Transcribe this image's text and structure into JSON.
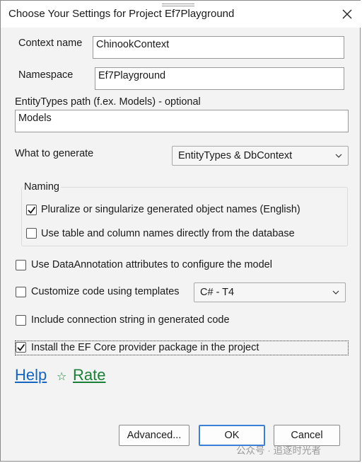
{
  "dialog": {
    "title": "Choose Your Settings for Project Ef7Playground"
  },
  "fields": {
    "context_name_label": "Context name",
    "context_name_value": "ChinookContext",
    "namespace_label": "Namespace",
    "namespace_value": "Ef7Playground",
    "entity_path_label": "EntityTypes path (f.ex. Models) - optional",
    "entity_path_value": "Models"
  },
  "generate": {
    "label": "What to generate",
    "selected": "EntityTypes & DbContext"
  },
  "naming": {
    "title": "Naming",
    "pluralize_label": "Pluralize or singularize generated object names (English)",
    "pluralize_checked": true,
    "use_db_names_label": "Use table and column names directly from the database",
    "use_db_names_checked": false
  },
  "options": {
    "data_annotations_label": "Use DataAnnotation attributes to configure the model",
    "data_annotations_checked": false,
    "templates_label": "Customize code using templates",
    "templates_checked": false,
    "templates_selected": "C# - T4",
    "connection_string_label": "Include connection string in generated code",
    "connection_string_checked": false,
    "install_provider_label": "Install the EF Core provider package in the project",
    "install_provider_checked": true
  },
  "links": {
    "help": "Help",
    "rate": "Rate"
  },
  "buttons": {
    "advanced": "Advanced...",
    "ok": "OK",
    "cancel": "Cancel"
  },
  "watermark": "公众号 · 追逐时光者",
  "colors": {
    "link": "#1565c0",
    "rate": "#1a7f37",
    "default_button_border": "#3c7fd6"
  }
}
